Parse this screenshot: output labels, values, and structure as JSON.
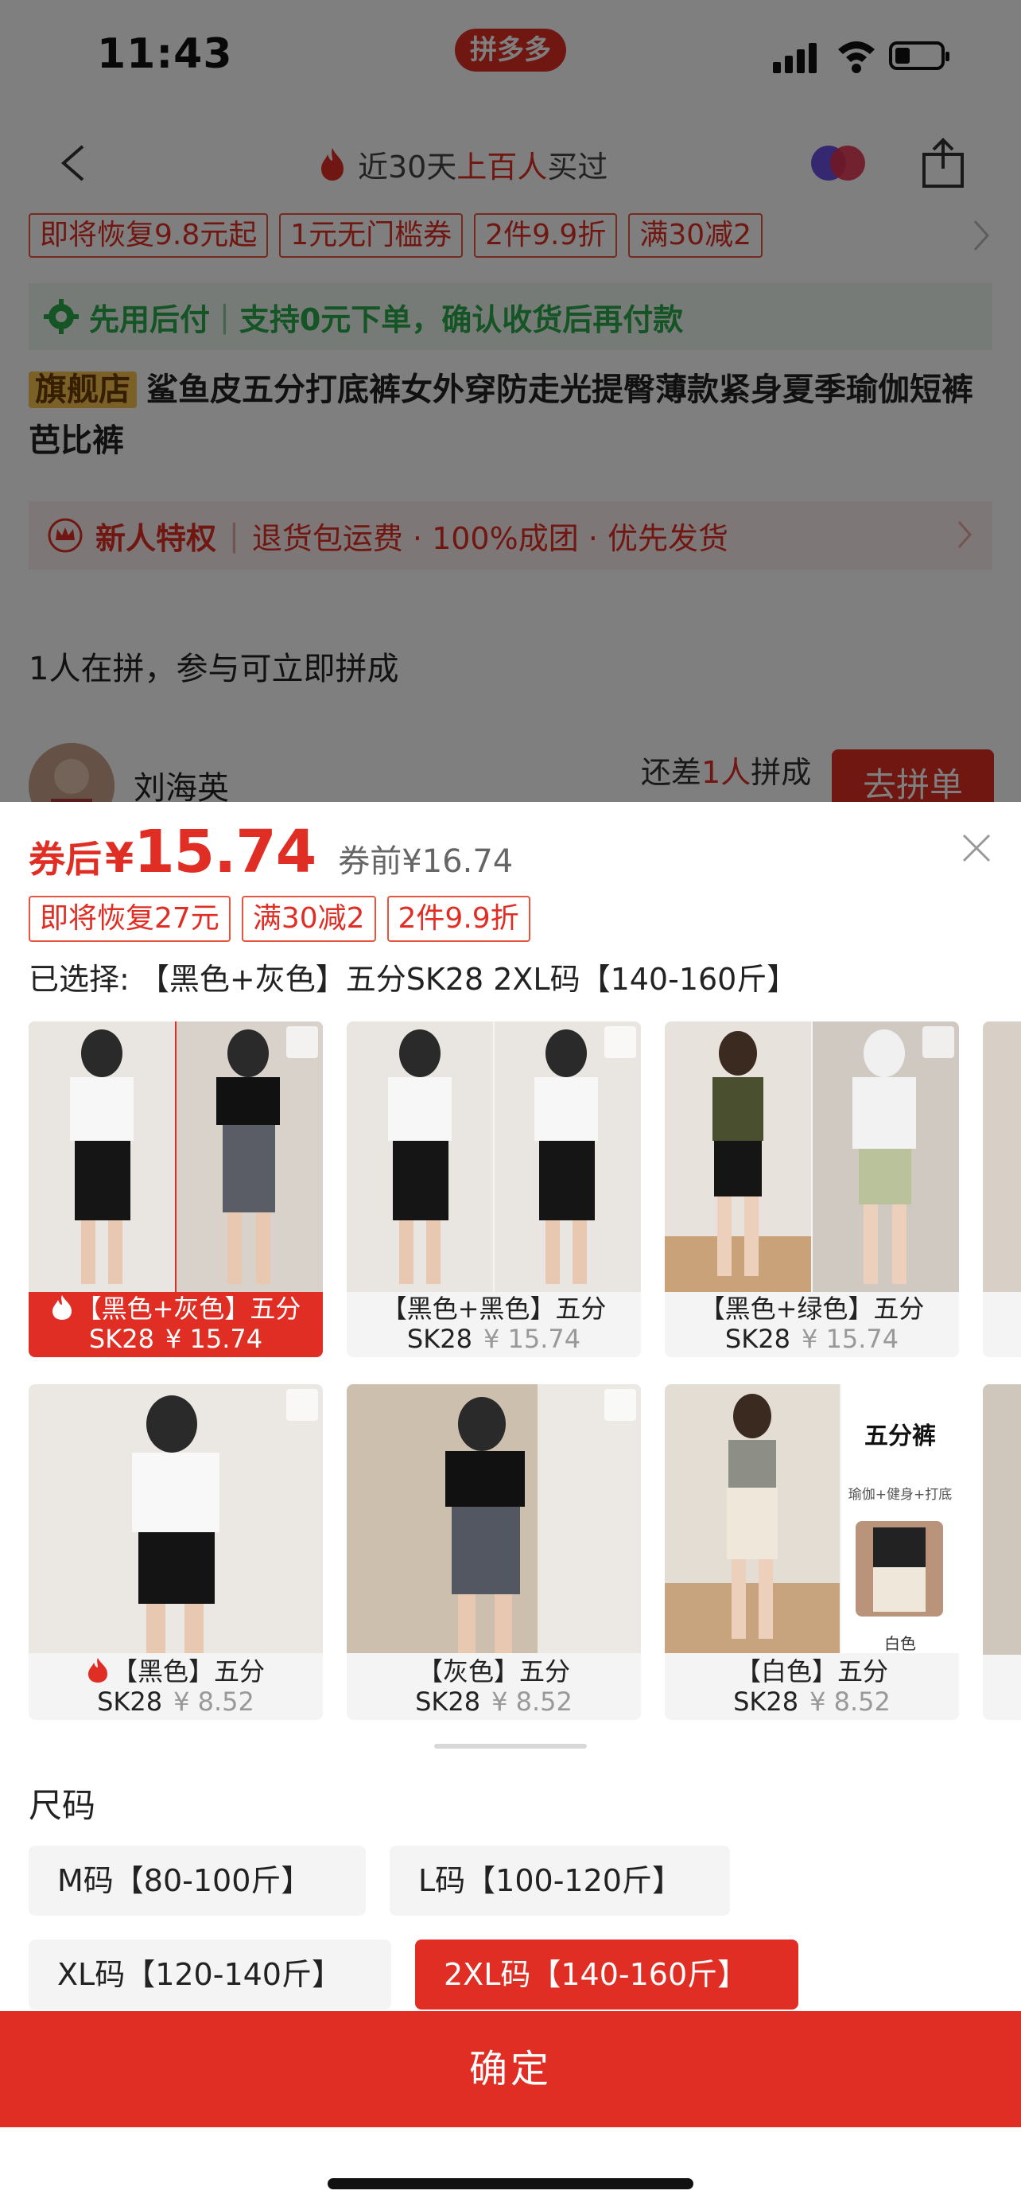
{
  "status_bar": {
    "time": "11:43",
    "app_badge": "拼多多"
  },
  "nav": {
    "text_before": "近30天",
    "text_highlight": "上百人",
    "text_after": "买过"
  },
  "coupon_strip": [
    "即将恢复9.8元起",
    "1元无门槛券",
    "2件9.9折",
    "满30减2"
  ],
  "pay_later": {
    "label": "先用后付",
    "detail": "支持0元下单，确认收货后再付款"
  },
  "product": {
    "badge": "旗舰店",
    "title": "鲨鱼皮五分打底裤女外穿防走光提臀薄款紧身夏季瑜伽短裤芭比裤"
  },
  "new_user_bar": {
    "label": "新人特权",
    "detail": "退货包运费 · 100%成团 · 优先发货"
  },
  "group": {
    "title": "1人在拼，参与可立即拼成",
    "user_name": "刘海英",
    "lack_prefix": "还差",
    "lack_count": "1人",
    "lack_suffix": "拼成",
    "join_label": "去拼单"
  },
  "sheet": {
    "price_label": "券后",
    "price_currency": "¥",
    "price_value": "15.74",
    "price_before": "券前¥16.74",
    "tags": [
      "即将恢复27元",
      "满30减2",
      "2件9.9折"
    ],
    "selected_text": "已选择: 【黑色+灰色】五分SK28 2XL码【140-160斤】",
    "variants": [
      {
        "name": "【黑色+灰色】五分",
        "code": "SK28",
        "price": "¥ 15.74",
        "hot": true,
        "selected": true
      },
      {
        "name": "【黑色+黑色】五分",
        "code": "SK28",
        "price": "¥ 15.74",
        "hot": false,
        "selected": false
      },
      {
        "name": "【黑色+绿色】五分",
        "code": "SK28",
        "price": "¥ 15.74",
        "hot": false,
        "selected": false
      },
      {
        "name": "【黑色】五分",
        "code": "SK28",
        "price": "¥ 8.52",
        "hot": true,
        "selected": false
      },
      {
        "name": "【灰色】五分",
        "code": "SK28",
        "price": "¥ 8.52",
        "hot": false,
        "selected": false
      },
      {
        "name": "【白色】五分",
        "code": "SK28",
        "price": "¥ 8.52",
        "hot": false,
        "selected": false
      }
    ],
    "variant_image_text": {
      "title": "五分裤",
      "subtitle": "瑜伽+健身+打底",
      "caption": "白色"
    },
    "size_title": "尺码",
    "sizes": [
      {
        "label": "M码【80-100斤】",
        "selected": false
      },
      {
        "label": "L码【100-120斤】",
        "selected": false
      },
      {
        "label": "XL码【120-140斤】",
        "selected": false
      },
      {
        "label": "2XL码【140-160斤】",
        "selected": true
      }
    ],
    "confirm_label": "确定"
  },
  "colors": {
    "brand_red": "#e02e24",
    "pay_green": "#29a84a",
    "chip_bg": "#f4f4f4"
  }
}
